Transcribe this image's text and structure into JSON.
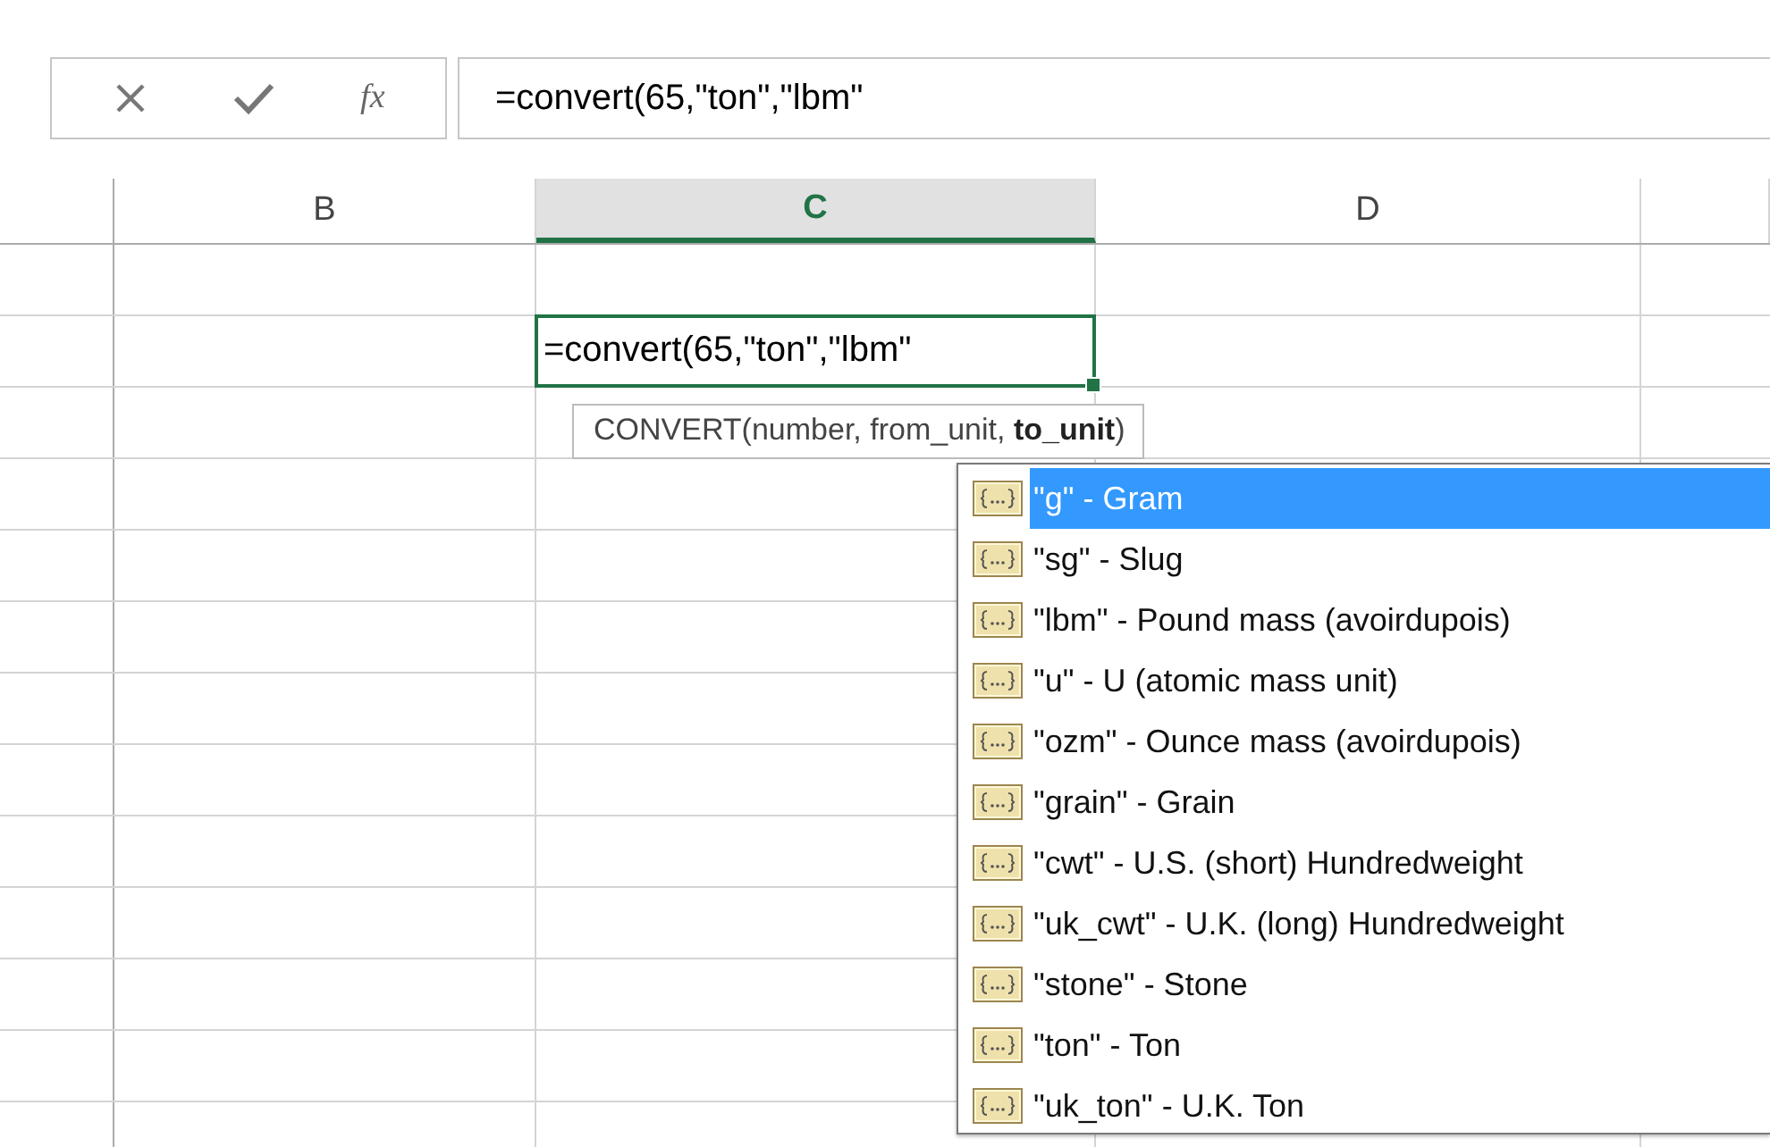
{
  "formula_bar": {
    "function_label": "fx",
    "formula": "=convert(65,\"ton\",\"lbm\""
  },
  "columns": [
    {
      "label": "B",
      "selected": false
    },
    {
      "label": "C",
      "selected": true
    },
    {
      "label": "D",
      "selected": false
    }
  ],
  "active_cell": {
    "value": "=convert(65,\"ton\",\"lbm\""
  },
  "tooltip": "CONVERT(number, from_unit, **to_unit**)",
  "autocomplete": [
    {
      "label": "\"g\" - Gram",
      "selected": true
    },
    {
      "label": "\"sg\" - Slug",
      "selected": false
    },
    {
      "label": "\"lbm\" - Pound mass (avoirdupois)",
      "selected": false
    },
    {
      "label": "\"u\" - U (atomic mass unit)",
      "selected": false
    },
    {
      "label": "\"ozm\" - Ounce mass (avoirdupois)",
      "selected": false
    },
    {
      "label": "\"grain\" - Grain",
      "selected": false
    },
    {
      "label": "\"cwt\" - U.S. (short) Hundredweight",
      "selected": false
    },
    {
      "label": "\"uk_cwt\" - U.K. (long) Hundredweight",
      "selected": false
    },
    {
      "label": "\"stone\" - Stone",
      "selected": false
    },
    {
      "label": "\"ton\" - Ton",
      "selected": false
    },
    {
      "label": "\"uk_ton\" - U.K. Ton",
      "selected": false
    }
  ]
}
